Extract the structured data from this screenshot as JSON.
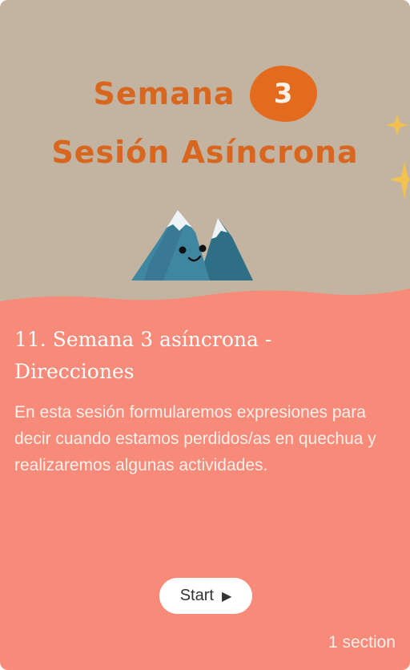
{
  "hero": {
    "week_word": "Semana",
    "week_number": "3",
    "subtitle": "Sesión Asíncrona",
    "illustration": "mountain-mascot",
    "background_color": "#c2b4a0",
    "accent_color": "#e36b1e"
  },
  "course": {
    "title": "11. Semana 3 asíncrona - Direcciones",
    "description": "En esta sesión formularemos expresiones para decir cuando estamos perdidos/as en quechua y realizaremos algunas actividades.",
    "start_label": "Start",
    "start_icon": "play-icon",
    "sections_label": "1 section",
    "card_color": "#f78a78"
  }
}
